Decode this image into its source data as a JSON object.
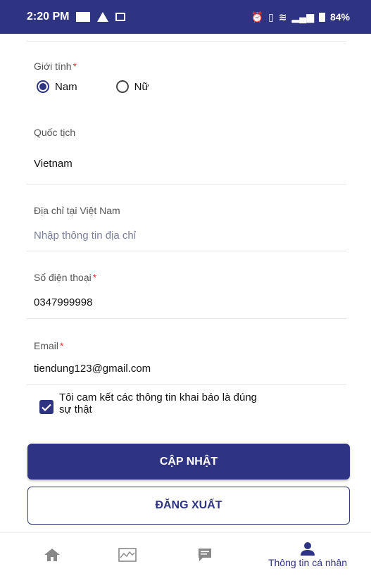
{
  "status_bar": {
    "time": "2:20 PM",
    "battery": "84%"
  },
  "form": {
    "gender": {
      "label": "Giới tính",
      "required_mark": "*",
      "options": [
        {
          "label": "Nam",
          "selected": true
        },
        {
          "label": "Nữ",
          "selected": false
        }
      ]
    },
    "nationality": {
      "label": "Quốc tịch",
      "value": "Vietnam"
    },
    "address": {
      "label": "Địa chỉ tại Việt Nam",
      "placeholder": "Nhập thông tin địa chỉ"
    },
    "phone": {
      "label": "Số điện thoại",
      "required_mark": "*",
      "value": "0347999998"
    },
    "email": {
      "label": "Email",
      "required_mark": "*",
      "value": "tiendung123@gmail.com"
    },
    "commitment": {
      "checked": true,
      "line1": "Tôi cam kết các thông tin khai báo là đúng",
      "line2": "sự thật"
    }
  },
  "actions": {
    "update_label": "CẬP NHẬT",
    "logout_label": "ĐĂNG XUẤT"
  },
  "bottom_nav": {
    "items": [
      {
        "icon": "home-icon",
        "label": ""
      },
      {
        "icon": "chart-icon",
        "label": ""
      },
      {
        "icon": "message-icon",
        "label": ""
      },
      {
        "icon": "person-icon",
        "label": "Thông tin cá nhân",
        "active": true
      }
    ]
  },
  "colors": {
    "primary": "#2e3382",
    "required": "#e53935"
  }
}
